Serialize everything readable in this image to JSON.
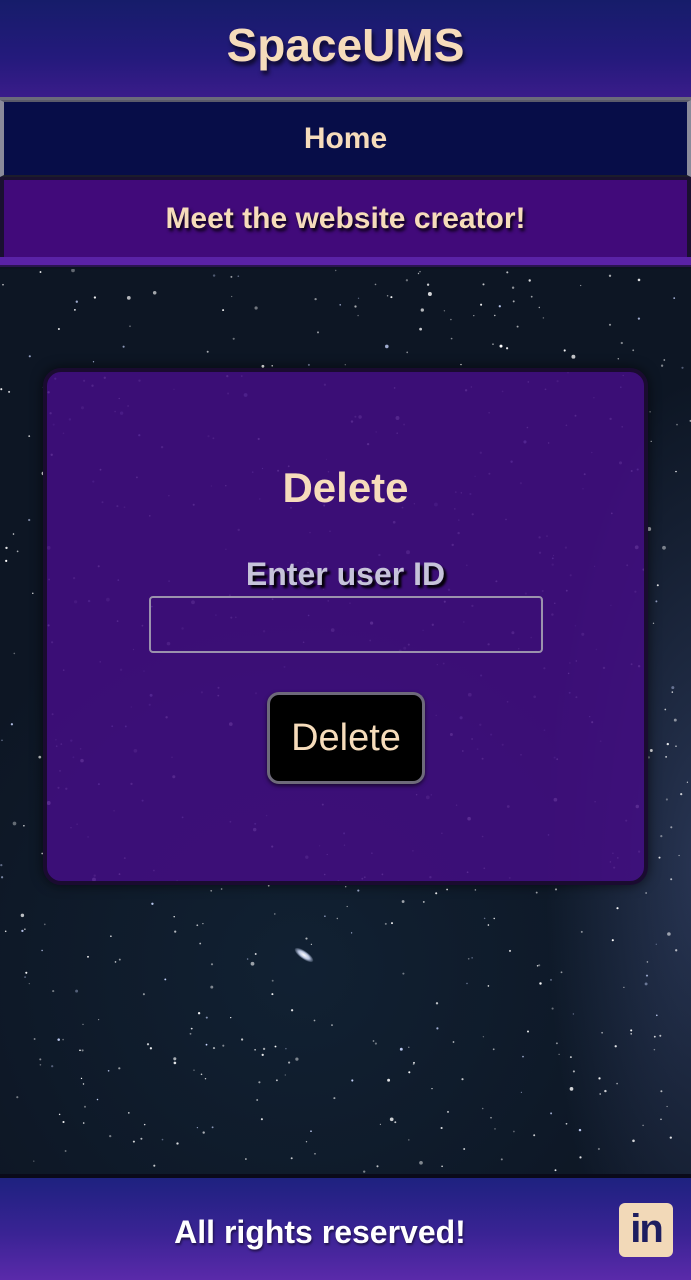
{
  "header": {
    "title": "SpaceUMS"
  },
  "nav": {
    "items": [
      {
        "label": "Home"
      },
      {
        "label": "Meet the website creator!"
      }
    ]
  },
  "card": {
    "title": "Delete",
    "field_label": "Enter user ID",
    "input_value": "",
    "input_placeholder": "",
    "button_label": "Delete"
  },
  "footer": {
    "text": "All rights reserved!",
    "social_icon": "linkedin-icon",
    "social_text": "in"
  },
  "colors": {
    "accent_text": "#f6dcbb",
    "header_bg": "#241a7c",
    "nav_home_bg": "#070d48",
    "nav_creator_bg": "#410a7a",
    "card_bg": "#420e82",
    "button_bg": "#000000"
  }
}
